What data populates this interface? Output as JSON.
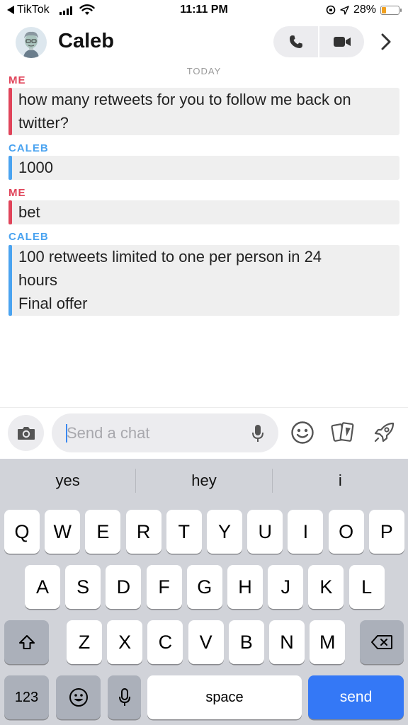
{
  "status_bar": {
    "back_app": "TikTok",
    "time": "11:11 PM",
    "battery": "28%",
    "battery_level": 0.28
  },
  "header": {
    "contact_name": "Caleb",
    "icons": [
      "avatar",
      "phone-icon",
      "video-icon",
      "chevron-right-icon"
    ]
  },
  "chat": {
    "day_label": "TODAY",
    "messages": [
      {
        "sender": "ME",
        "lines": [
          "how many retweets for you to follow me back on",
          "twitter?"
        ]
      },
      {
        "sender": "CALEB",
        "lines": [
          "1000"
        ]
      },
      {
        "sender": "ME",
        "lines": [
          "bet"
        ]
      },
      {
        "sender": "CALEB",
        "lines": [
          "100 retweets limited to one per person in 24",
          "hours",
          "Final offer"
        ]
      }
    ]
  },
  "composer": {
    "placeholder": "Send a chat",
    "icons": [
      "camera-icon",
      "mic-icon",
      "emoji-icon",
      "cards-icon",
      "rocket-icon"
    ]
  },
  "keyboard": {
    "suggestions": [
      "yes",
      "hey",
      "i"
    ],
    "row1": [
      "Q",
      "W",
      "E",
      "R",
      "T",
      "Y",
      "U",
      "I",
      "O",
      "P"
    ],
    "row2": [
      "A",
      "S",
      "D",
      "F",
      "G",
      "H",
      "J",
      "K",
      "L"
    ],
    "row3": [
      "Z",
      "X",
      "C",
      "V",
      "B",
      "N",
      "M"
    ],
    "numbers_label": "123",
    "space_label": "space",
    "send_label": "send"
  },
  "colors": {
    "me": "#e0445a",
    "them": "#4aa3f0",
    "send_key": "#3478f6"
  }
}
